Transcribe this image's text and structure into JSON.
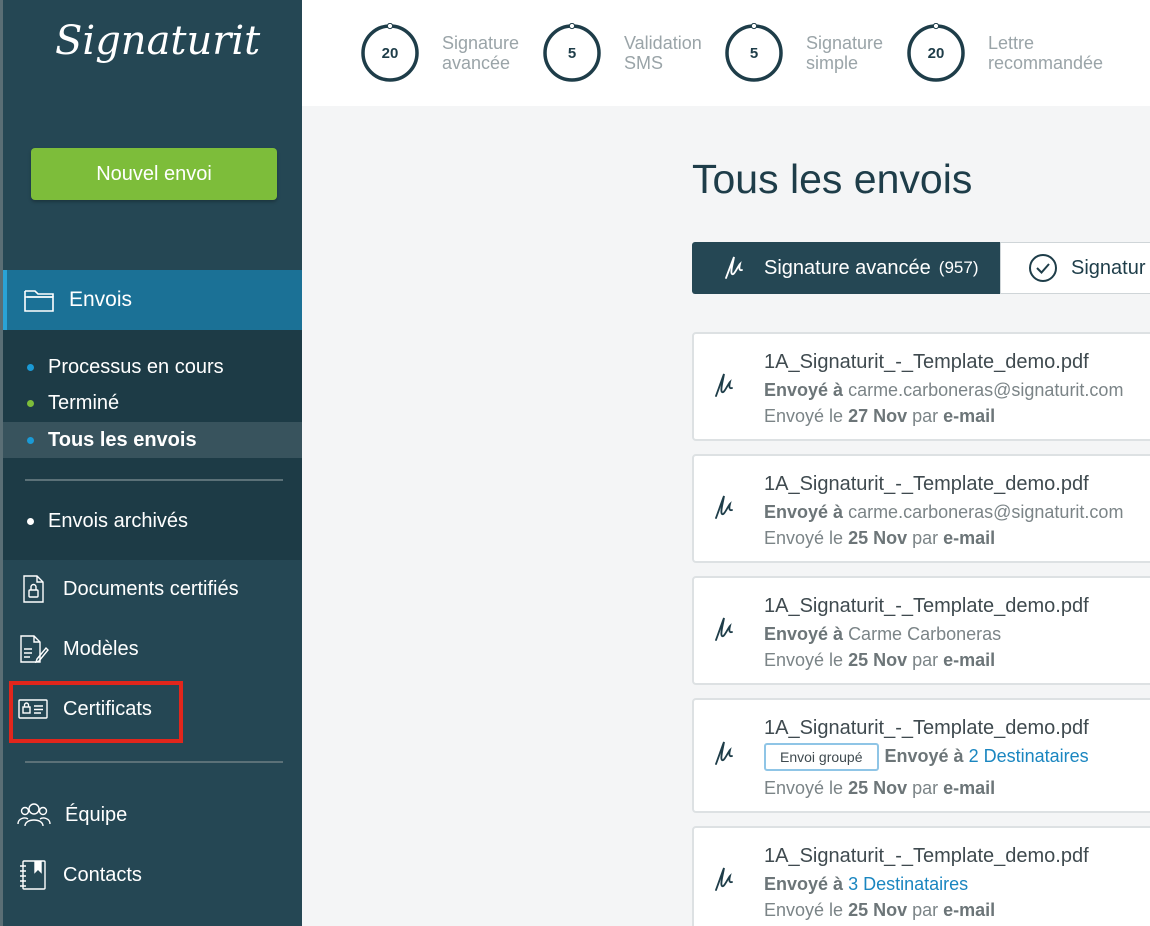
{
  "app": {
    "logo_text": "Signaturit",
    "colors": {
      "sidebar": "#254754",
      "accent": "#1b7196",
      "primary_button": "#7dbd3a",
      "highlight": "#e1261c",
      "link": "#1a86c0"
    }
  },
  "sidebar": {
    "new_button": "Nouvel envoi",
    "envois": {
      "label": "Envois",
      "icon": "folder-icon"
    },
    "subitems": [
      {
        "label": "Processus en cours",
        "dot": "#1a9ad6"
      },
      {
        "label": "Terminé",
        "dot": "#7dbd3a"
      },
      {
        "label": "Tous les envois",
        "dot": "#1a9ad6"
      }
    ],
    "archived": "Envois archivés",
    "items": [
      {
        "label": "Documents certifiés",
        "icon": "certified-document-icon"
      },
      {
        "label": "Modèles",
        "icon": "template-icon"
      },
      {
        "label": "Certificats",
        "icon": "certificate-card-icon"
      }
    ],
    "bottom_items": [
      {
        "label": "Équipe",
        "icon": "team-icon"
      },
      {
        "label": "Contacts",
        "icon": "contacts-book-icon"
      }
    ]
  },
  "topbar": {
    "counters": [
      {
        "value": "20",
        "line1": "Signature",
        "line2": "avancée",
        "progress": 0.02
      },
      {
        "value": "5",
        "line1": "Validation",
        "line2": "SMS",
        "progress": 0.02
      },
      {
        "value": "5",
        "line1": "Signature",
        "line2": "simple",
        "progress": 0.02
      },
      {
        "value": "20",
        "line1": "Lettre",
        "line2": "recommandée",
        "progress": 0.02
      }
    ]
  },
  "main": {
    "title": "Tous les envois",
    "tabs": [
      {
        "label": "Signature avancée",
        "count": "(957)"
      },
      {
        "label": "Signatur"
      }
    ],
    "cards": [
      {
        "file": "1A_Signaturit_-_Template_demo.pdf",
        "sent_to_label": "Envoyé à",
        "sent_to": "carme.carboneras@signaturit.com",
        "date_prefix": "Envoyé le",
        "date": "27 Nov",
        "by": "par",
        "channel": "e-mail"
      },
      {
        "file": "1A_Signaturit_-_Template_demo.pdf",
        "sent_to_label": "Envoyé à",
        "sent_to": "carme.carboneras@signaturit.com",
        "date_prefix": "Envoyé le",
        "date": "25 Nov",
        "by": "par",
        "channel": "e-mail"
      },
      {
        "file": "1A_Signaturit_-_Template_demo.pdf",
        "sent_to_label": "Envoyé à",
        "sent_to": "Carme Carboneras",
        "date_prefix": "Envoyé le",
        "date": "25 Nov",
        "by": "par",
        "channel": "e-mail"
      },
      {
        "file": "1A_Signaturit_-_Template_demo.pdf",
        "badge": "Envoi groupé",
        "sent_to_label": "Envoyé à",
        "sent_to": "2 Destinataires",
        "date_prefix": "Envoyé le",
        "date": "25 Nov",
        "by": "par",
        "channel": "e-mail"
      },
      {
        "file": "1A_Signaturit_-_Template_demo.pdf",
        "sent_to_label": "Envoyé à",
        "sent_to": "3 Destinataires",
        "date_prefix": "Envoyé le",
        "date": "25 Nov",
        "by": "par",
        "channel": "e-mail"
      }
    ]
  }
}
